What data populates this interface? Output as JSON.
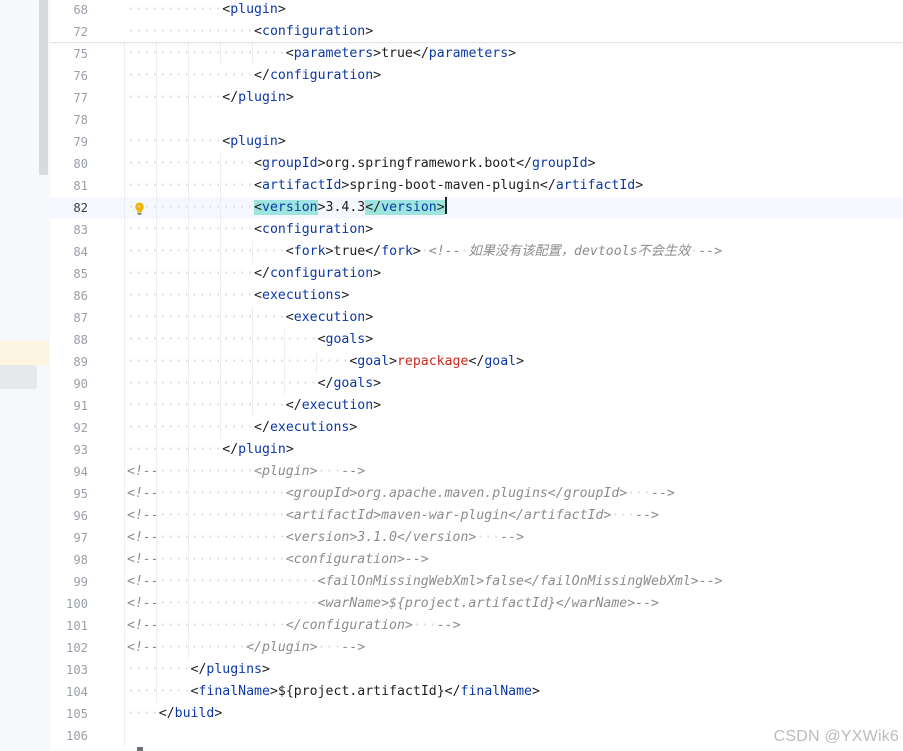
{
  "editor": {
    "lines": [
      {
        "num": "68",
        "segs": [
          {
            "c": "ws",
            "t": "············"
          },
          {
            "c": "br",
            "t": "<"
          },
          {
            "c": "tag",
            "t": "plugin"
          },
          {
            "c": "br",
            "t": ">"
          }
        ]
      },
      {
        "num": "72",
        "segs": [
          {
            "c": "ws",
            "t": "················"
          },
          {
            "c": "br",
            "t": "<"
          },
          {
            "c": "tag",
            "t": "configuration"
          },
          {
            "c": "br",
            "t": ">"
          }
        ]
      },
      {
        "num": "75",
        "segs": [
          {
            "c": "ws",
            "t": "····················"
          },
          {
            "c": "br",
            "t": "<"
          },
          {
            "c": "tag",
            "t": "parameters"
          },
          {
            "c": "br",
            "t": ">"
          },
          {
            "c": "txt",
            "t": "true"
          },
          {
            "c": "br",
            "t": "</"
          },
          {
            "c": "tag",
            "t": "parameters"
          },
          {
            "c": "br",
            "t": ">"
          }
        ]
      },
      {
        "num": "76",
        "segs": [
          {
            "c": "ws",
            "t": "················"
          },
          {
            "c": "br",
            "t": "</"
          },
          {
            "c": "tag",
            "t": "configuration"
          },
          {
            "c": "br",
            "t": ">"
          }
        ]
      },
      {
        "num": "77",
        "segs": [
          {
            "c": "ws",
            "t": "············"
          },
          {
            "c": "br",
            "t": "</"
          },
          {
            "c": "tag",
            "t": "plugin"
          },
          {
            "c": "br",
            "t": ">"
          }
        ]
      },
      {
        "num": "78",
        "segs": []
      },
      {
        "num": "79",
        "segs": [
          {
            "c": "ws",
            "t": "············"
          },
          {
            "c": "br",
            "t": "<"
          },
          {
            "c": "tag",
            "t": "plugin"
          },
          {
            "c": "br",
            "t": ">"
          }
        ]
      },
      {
        "num": "80",
        "segs": [
          {
            "c": "ws",
            "t": "················"
          },
          {
            "c": "br",
            "t": "<"
          },
          {
            "c": "tag",
            "t": "groupId"
          },
          {
            "c": "br",
            "t": ">"
          },
          {
            "c": "txt",
            "t": "org.springframework.boot"
          },
          {
            "c": "br",
            "t": "</"
          },
          {
            "c": "tag",
            "t": "groupId"
          },
          {
            "c": "br",
            "t": ">"
          }
        ]
      },
      {
        "num": "81",
        "segs": [
          {
            "c": "ws",
            "t": "················"
          },
          {
            "c": "br",
            "t": "<"
          },
          {
            "c": "tag",
            "t": "artifactId"
          },
          {
            "c": "br",
            "t": ">"
          },
          {
            "c": "txt",
            "t": "spring-boot-maven-plugin"
          },
          {
            "c": "br",
            "t": "</"
          },
          {
            "c": "tag",
            "t": "artifactId"
          },
          {
            "c": "br",
            "t": ">"
          }
        ]
      },
      {
        "num": "82",
        "current": true,
        "bulb": true,
        "segs": [
          {
            "c": "ws",
            "t": "················"
          },
          {
            "c": "br match",
            "t": "<"
          },
          {
            "c": "tag match",
            "t": "version"
          },
          {
            "c": "br",
            "t": ">"
          },
          {
            "c": "txt",
            "t": "3.4.3"
          },
          {
            "c": "br match",
            "t": "</"
          },
          {
            "c": "tag match",
            "t": "version"
          },
          {
            "c": "br match",
            "t": ">"
          },
          {
            "c": "caret",
            "t": ""
          }
        ]
      },
      {
        "num": "83",
        "segs": [
          {
            "c": "ws",
            "t": "················"
          },
          {
            "c": "br",
            "t": "<"
          },
          {
            "c": "tag",
            "t": "configuration"
          },
          {
            "c": "br",
            "t": ">"
          }
        ]
      },
      {
        "num": "84",
        "segs": [
          {
            "c": "ws",
            "t": "····················"
          },
          {
            "c": "br",
            "t": "<"
          },
          {
            "c": "tag",
            "t": "fork"
          },
          {
            "c": "br",
            "t": ">"
          },
          {
            "c": "txt",
            "t": "true"
          },
          {
            "c": "br",
            "t": "</"
          },
          {
            "c": "tag",
            "t": "fork"
          },
          {
            "c": "br",
            "t": ">"
          },
          {
            "c": "ws",
            "t": "·"
          },
          {
            "c": "cmt",
            "t": "<!--"
          },
          {
            "c": "ws",
            "t": "·"
          },
          {
            "c": "cmt",
            "t": "如果没有该配置，devtools不会生效"
          },
          {
            "c": "ws",
            "t": "·"
          },
          {
            "c": "cmt",
            "t": "-->"
          }
        ]
      },
      {
        "num": "85",
        "segs": [
          {
            "c": "ws",
            "t": "················"
          },
          {
            "c": "br",
            "t": "</"
          },
          {
            "c": "tag",
            "t": "configuration"
          },
          {
            "c": "br",
            "t": ">"
          }
        ]
      },
      {
        "num": "86",
        "segs": [
          {
            "c": "ws",
            "t": "················"
          },
          {
            "c": "br",
            "t": "<"
          },
          {
            "c": "tag",
            "t": "executions"
          },
          {
            "c": "br",
            "t": ">"
          }
        ]
      },
      {
        "num": "87",
        "segs": [
          {
            "c": "ws",
            "t": "····················"
          },
          {
            "c": "br",
            "t": "<"
          },
          {
            "c": "tag",
            "t": "execution"
          },
          {
            "c": "br",
            "t": ">"
          }
        ]
      },
      {
        "num": "88",
        "segs": [
          {
            "c": "ws",
            "t": "························"
          },
          {
            "c": "br",
            "t": "<"
          },
          {
            "c": "tag",
            "t": "goals"
          },
          {
            "c": "br",
            "t": ">"
          }
        ]
      },
      {
        "num": "89",
        "segs": [
          {
            "c": "ws",
            "t": "····························"
          },
          {
            "c": "br",
            "t": "<"
          },
          {
            "c": "tag",
            "t": "goal"
          },
          {
            "c": "br",
            "t": ">"
          },
          {
            "c": "red",
            "t": "repackage"
          },
          {
            "c": "br",
            "t": "</"
          },
          {
            "c": "tag",
            "t": "goal"
          },
          {
            "c": "br",
            "t": ">"
          }
        ]
      },
      {
        "num": "90",
        "segs": [
          {
            "c": "ws",
            "t": "························"
          },
          {
            "c": "br",
            "t": "</"
          },
          {
            "c": "tag",
            "t": "goals"
          },
          {
            "c": "br",
            "t": ">"
          }
        ]
      },
      {
        "num": "91",
        "segs": [
          {
            "c": "ws",
            "t": "····················"
          },
          {
            "c": "br",
            "t": "</"
          },
          {
            "c": "tag",
            "t": "execution"
          },
          {
            "c": "br",
            "t": ">"
          }
        ]
      },
      {
        "num": "92",
        "segs": [
          {
            "c": "ws",
            "t": "················"
          },
          {
            "c": "br",
            "t": "</"
          },
          {
            "c": "tag",
            "t": "executions"
          },
          {
            "c": "br",
            "t": ">"
          }
        ]
      },
      {
        "num": "93",
        "segs": [
          {
            "c": "ws",
            "t": "············"
          },
          {
            "c": "br",
            "t": "</"
          },
          {
            "c": "tag",
            "t": "plugin"
          },
          {
            "c": "br",
            "t": ">"
          }
        ]
      },
      {
        "num": "94",
        "segs": [
          {
            "c": "cmt",
            "t": "<!--"
          },
          {
            "c": "ws",
            "t": "············"
          },
          {
            "c": "cmt",
            "t": "<plugin>"
          },
          {
            "c": "ws",
            "t": "···"
          },
          {
            "c": "cmt",
            "t": "-->"
          }
        ]
      },
      {
        "num": "95",
        "segs": [
          {
            "c": "cmt",
            "t": "<!--"
          },
          {
            "c": "ws",
            "t": "················"
          },
          {
            "c": "cmt",
            "t": "<groupId>org.apache.maven.plugins</groupId>"
          },
          {
            "c": "ws",
            "t": "···"
          },
          {
            "c": "cmt",
            "t": "-->"
          }
        ]
      },
      {
        "num": "96",
        "segs": [
          {
            "c": "cmt",
            "t": "<!--"
          },
          {
            "c": "ws",
            "t": "················"
          },
          {
            "c": "cmt",
            "t": "<artifactId>maven-war-plugin</artifactId>"
          },
          {
            "c": "ws",
            "t": "···"
          },
          {
            "c": "cmt",
            "t": "-->"
          }
        ]
      },
      {
        "num": "97",
        "segs": [
          {
            "c": "cmt",
            "t": "<!--"
          },
          {
            "c": "ws",
            "t": "················"
          },
          {
            "c": "cmt",
            "t": "<version>3.1.0</version>"
          },
          {
            "c": "ws",
            "t": "···"
          },
          {
            "c": "cmt",
            "t": "-->"
          }
        ]
      },
      {
        "num": "98",
        "segs": [
          {
            "c": "cmt",
            "t": "<!--"
          },
          {
            "c": "ws",
            "t": "················"
          },
          {
            "c": "cmt",
            "t": "<configuration>-->"
          }
        ]
      },
      {
        "num": "99",
        "segs": [
          {
            "c": "cmt",
            "t": "<!--"
          },
          {
            "c": "ws",
            "t": "····················"
          },
          {
            "c": "cmt",
            "t": "<failOnMissingWebXml>false</failOnMissingWebXml>-->"
          }
        ]
      },
      {
        "num": "100",
        "segs": [
          {
            "c": "cmt",
            "t": "<!--"
          },
          {
            "c": "ws",
            "t": "····················"
          },
          {
            "c": "cmt",
            "t": "<warName>${project.artifactId}</warName>-->"
          }
        ]
      },
      {
        "num": "101",
        "segs": [
          {
            "c": "cmt",
            "t": "<!--"
          },
          {
            "c": "ws",
            "t": "················"
          },
          {
            "c": "cmt",
            "t": "</configuration>"
          },
          {
            "c": "ws",
            "t": "···"
          },
          {
            "c": "cmt",
            "t": "-->"
          }
        ]
      },
      {
        "num": "102",
        "segs": [
          {
            "c": "cmt",
            "t": "<!--"
          },
          {
            "c": "ws",
            "t": "···········"
          },
          {
            "c": "cmt",
            "t": "</plugin>"
          },
          {
            "c": "ws",
            "t": "···"
          },
          {
            "c": "cmt",
            "t": "-->"
          }
        ]
      },
      {
        "num": "103",
        "segs": [
          {
            "c": "ws",
            "t": "········"
          },
          {
            "c": "br",
            "t": "</"
          },
          {
            "c": "tag",
            "t": "plugins"
          },
          {
            "c": "br",
            "t": ">"
          }
        ]
      },
      {
        "num": "104",
        "segs": [
          {
            "c": "ws",
            "t": "········"
          },
          {
            "c": "br",
            "t": "<"
          },
          {
            "c": "tag",
            "t": "finalName"
          },
          {
            "c": "br",
            "t": ">"
          },
          {
            "c": "txt",
            "t": "${project.artifactId}"
          },
          {
            "c": "br",
            "t": "</"
          },
          {
            "c": "tag",
            "t": "finalName"
          },
          {
            "c": "br",
            "t": ">"
          }
        ]
      },
      {
        "num": "105",
        "segs": [
          {
            "c": "ws",
            "t": "····"
          },
          {
            "c": "br",
            "t": "</"
          },
          {
            "c": "tag",
            "t": "build"
          },
          {
            "c": "br",
            "t": ">"
          }
        ]
      },
      {
        "num": "106",
        "segs": []
      }
    ]
  },
  "icons": {
    "gutter_intention": "lightbulb-icon"
  },
  "colors": {
    "tag": "#0b38a8",
    "value_red": "#c8291e",
    "comment": "#8c8c8c",
    "bracket_match": "#9fe5df",
    "current_line": "#f5f8fe"
  },
  "watermark": "CSDN @YXWik6"
}
